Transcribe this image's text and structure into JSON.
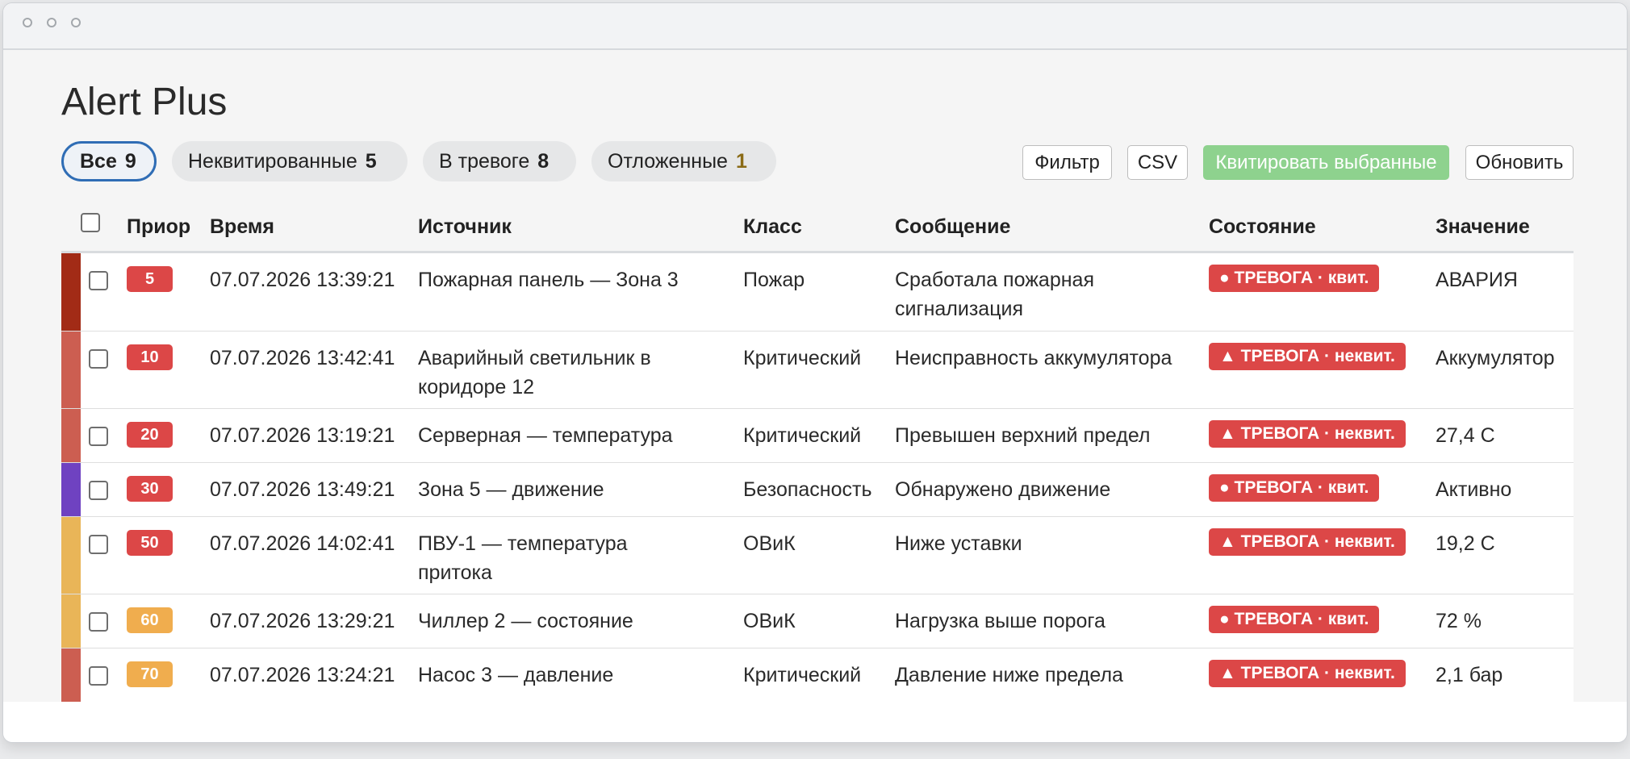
{
  "window": {
    "title": "Alert Plus"
  },
  "tabs": [
    {
      "label": "Все",
      "count": "9"
    },
    {
      "label": "Неквитированные",
      "count": "5"
    },
    {
      "label": "В тревоге",
      "count": "8"
    },
    {
      "label": "Отложенные",
      "count": "1"
    }
  ],
  "toolbar": {
    "filter": "Фильтр",
    "csv": "CSV",
    "ack_selected": "Квитировать выбранные",
    "refresh": "Обновить"
  },
  "columns": {
    "priority": "Приор",
    "time": "Время",
    "source": "Источник",
    "class": "Класс",
    "message": "Сообщение",
    "state": "Состояние",
    "value": "Значение"
  },
  "colors": {
    "accent": "#2f6db5",
    "ack_button": "#8ed28e",
    "state_badge": "#dc4747",
    "prio_red": "#dc4747",
    "prio_orange": "#f0ad4e",
    "stripe_dark_red": "#a22b16",
    "stripe_red": "#cc5e51",
    "stripe_purple": "#6f42c1",
    "stripe_yellow": "#e9b558"
  },
  "alarms": [
    {
      "priority": "5",
      "time": "07.07.2026 13:39:21",
      "source": "Пожарная панель — Зона 3",
      "class": "Пожар",
      "message": "Сработала пожарная сигнализация",
      "state": "● ТРЕВОГА · квит.",
      "value": "АВАРИЯ"
    },
    {
      "priority": "10",
      "time": "07.07.2026 13:42:41",
      "source": "Аварийный светильник в коридоре 12",
      "class": "Критический",
      "message": "Неисправность аккумулятора",
      "state": "▲ ТРЕВОГА · неквит.",
      "value": "Аккумулятор"
    },
    {
      "priority": "20",
      "time": "07.07.2026 13:19:21",
      "source": "Серверная — температура",
      "class": "Критический",
      "message": "Превышен верхний предел",
      "state": "▲ ТРЕВОГА · неквит.",
      "value": "27,4 C"
    },
    {
      "priority": "30",
      "time": "07.07.2026 13:49:21",
      "source": "Зона 5 — движение",
      "class": "Безопасность",
      "message": "Обнаружено движение",
      "state": "● ТРЕВОГА · квит.",
      "value": "Активно"
    },
    {
      "priority": "50",
      "time": "07.07.2026 14:02:41",
      "source": "ПВУ-1 — температура притока",
      "class": "ОВиК",
      "message": "Ниже уставки",
      "state": "▲ ТРЕВОГА · неквит.",
      "value": "19,2 C"
    },
    {
      "priority": "60",
      "time": "07.07.2026 13:29:21",
      "source": "Чиллер 2 — состояние",
      "class": "ОВиК",
      "message": "Нагрузка выше порога",
      "state": "● ТРЕВОГА · квит.",
      "value": "72 %"
    },
    {
      "priority": "70",
      "time": "07.07.2026 13:24:21",
      "source": "Насос 3 — давление",
      "class": "Критический",
      "message": "Давление ниже предела",
      "state": "▲ ТРЕВОГА · неквит.",
      "value": "2,1 бар"
    }
  ]
}
